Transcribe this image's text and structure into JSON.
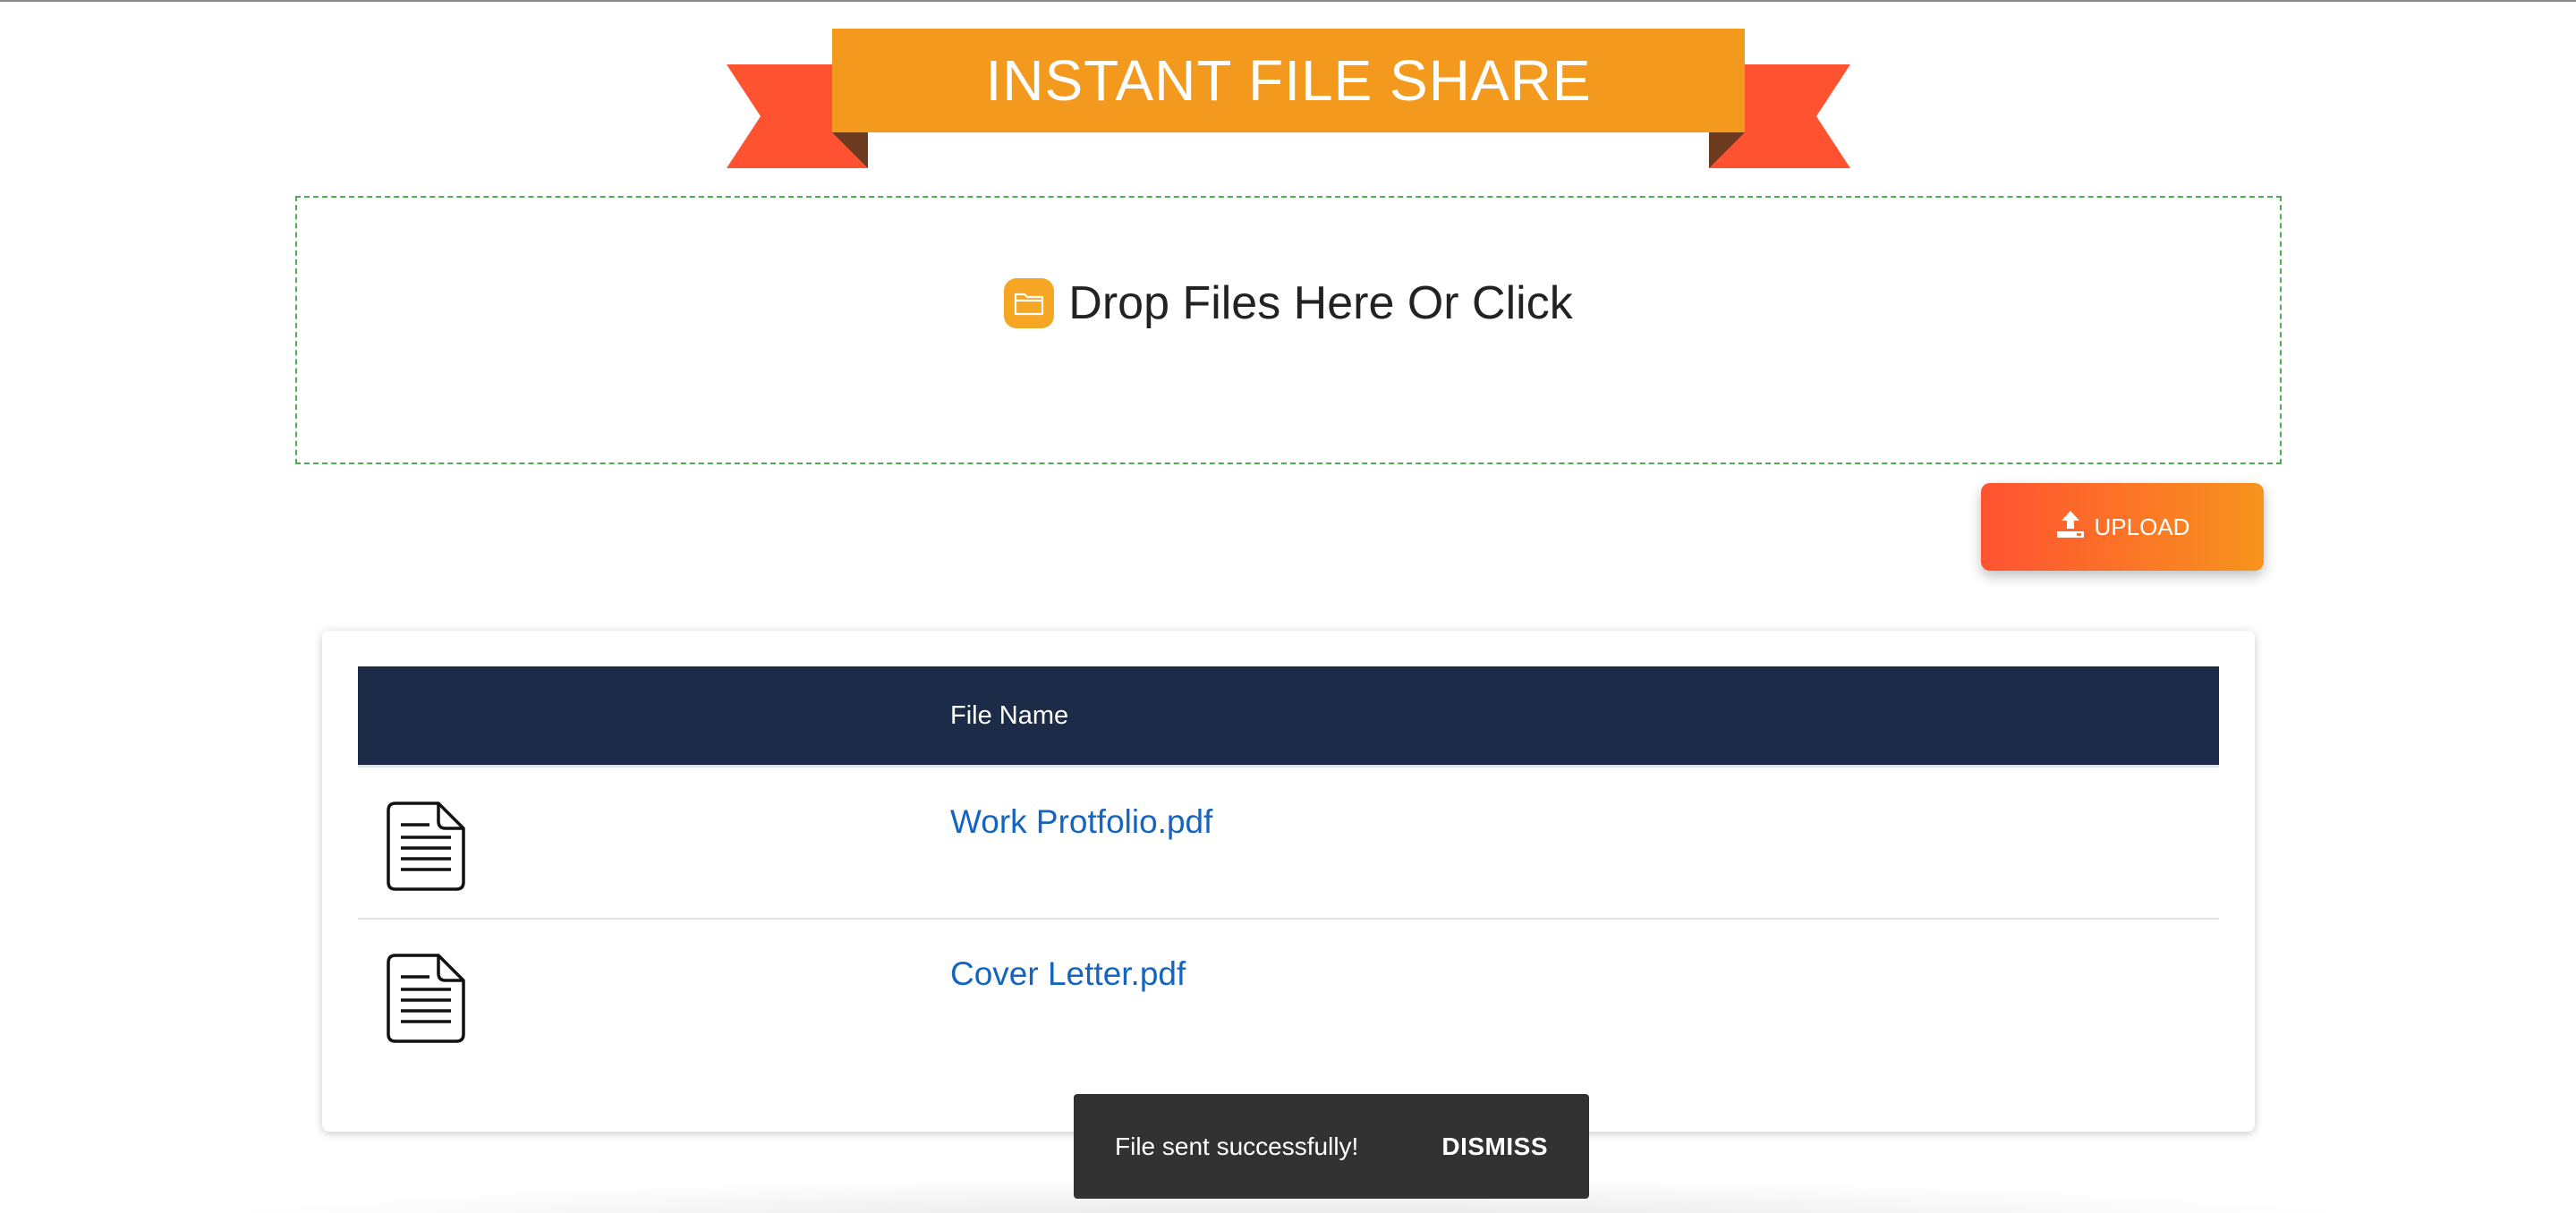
{
  "header": {
    "title": "INSTANT FILE SHARE"
  },
  "dropzone": {
    "label": "Drop Files Here Or Click",
    "icon": "folder-icon"
  },
  "upload": {
    "label": "UPLOAD",
    "icon": "upload-icon"
  },
  "files_table": {
    "columns": [
      "",
      "File Name"
    ],
    "rows": [
      {
        "icon": "document-icon",
        "name": "Work Protfolio.pdf"
      },
      {
        "icon": "document-icon",
        "name": "Cover Letter.pdf"
      }
    ]
  },
  "snackbar": {
    "message": "File sent successfully!",
    "action": "DISMISS"
  },
  "colors": {
    "ribbon_main": "#f39a1e",
    "ribbon_tail": "#ff5230",
    "ribbon_fold": "#6b3a1f",
    "table_header": "#1c2b48",
    "link": "#1565c0",
    "dropzone_border": "#4caf50",
    "snackbar_bg": "#323232"
  }
}
